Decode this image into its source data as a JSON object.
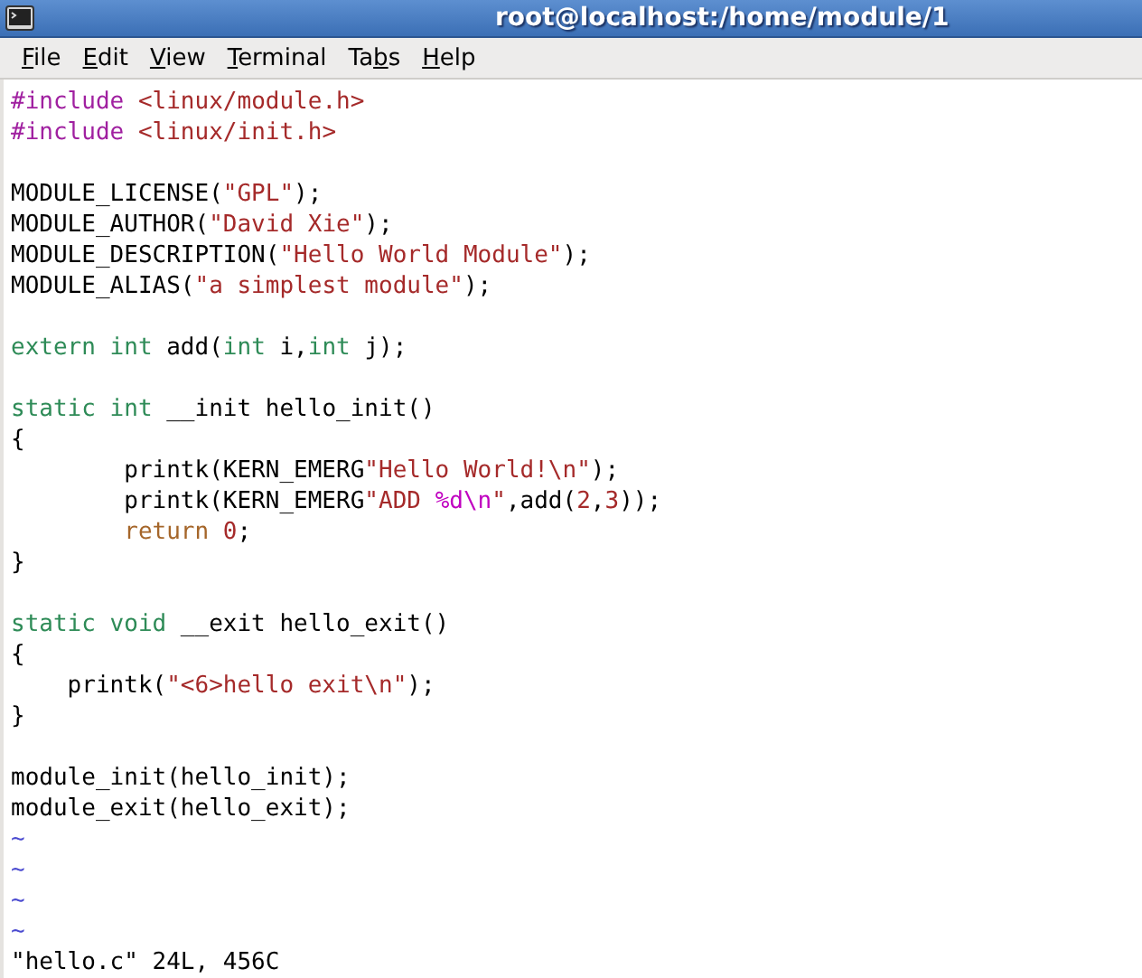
{
  "window": {
    "title": "root@localhost:/home/module/1"
  },
  "menu": [
    {
      "mnemonic": "F",
      "after": "ile"
    },
    {
      "mnemonic": "E",
      "after": "dit"
    },
    {
      "mnemonic": "V",
      "after": "iew"
    },
    {
      "mnemonic": "T",
      "after": "erminal"
    },
    {
      "before": "Ta",
      "mnemonic": "b",
      "after": "s"
    },
    {
      "mnemonic": "H",
      "after": "elp"
    }
  ],
  "editor": {
    "lines": [
      {
        "kind": "code",
        "tokens": [
          {
            "text": "#include ",
            "kind": "preproc"
          },
          {
            "text": "<linux/module.h>",
            "kind": "string"
          }
        ]
      },
      {
        "kind": "code",
        "tokens": [
          {
            "text": "#include ",
            "kind": "preproc"
          },
          {
            "text": "<linux/init.h>",
            "kind": "string"
          }
        ]
      },
      {
        "kind": "blank"
      },
      {
        "kind": "code",
        "tokens": [
          {
            "text": "MODULE_LICENSE(",
            "kind": "plain"
          },
          {
            "text": "\"GPL\"",
            "kind": "string"
          },
          {
            "text": ");",
            "kind": "plain"
          }
        ]
      },
      {
        "kind": "code",
        "tokens": [
          {
            "text": "MODULE_AUTHOR(",
            "kind": "plain"
          },
          {
            "text": "\"David Xie\"",
            "kind": "string"
          },
          {
            "text": ");",
            "kind": "plain"
          }
        ]
      },
      {
        "kind": "code",
        "tokens": [
          {
            "text": "MODULE_DESCRIPTION(",
            "kind": "plain"
          },
          {
            "text": "\"Hello World Module\"",
            "kind": "string"
          },
          {
            "text": ");",
            "kind": "plain"
          }
        ]
      },
      {
        "kind": "code",
        "tokens": [
          {
            "text": "MODULE_ALIAS(",
            "kind": "plain"
          },
          {
            "text": "\"a simplest module\"",
            "kind": "string"
          },
          {
            "text": ");",
            "kind": "plain"
          }
        ]
      },
      {
        "kind": "blank"
      },
      {
        "kind": "code",
        "tokens": [
          {
            "text": "extern int",
            "kind": "type"
          },
          {
            "text": " add(",
            "kind": "plain"
          },
          {
            "text": "int",
            "kind": "type"
          },
          {
            "text": " i,",
            "kind": "plain"
          },
          {
            "text": "int",
            "kind": "type"
          },
          {
            "text": " j);",
            "kind": "plain"
          }
        ]
      },
      {
        "kind": "blank"
      },
      {
        "kind": "code",
        "tokens": [
          {
            "text": "static int",
            "kind": "type"
          },
          {
            "text": " __init hello_init()",
            "kind": "plain"
          }
        ]
      },
      {
        "kind": "code",
        "tokens": [
          {
            "text": "{",
            "kind": "plain"
          }
        ]
      },
      {
        "kind": "code",
        "tokens": [
          {
            "text": "        printk(KERN_EMERG",
            "kind": "plain"
          },
          {
            "text": "\"Hello World!\\n\"",
            "kind": "string"
          },
          {
            "text": ");",
            "kind": "plain"
          }
        ]
      },
      {
        "kind": "code",
        "tokens": [
          {
            "text": "        printk(KERN_EMERG",
            "kind": "plain"
          },
          {
            "text": "\"ADD ",
            "kind": "string"
          },
          {
            "text": "%d\\n",
            "kind": "special"
          },
          {
            "text": "\"",
            "kind": "string"
          },
          {
            "text": ",add(",
            "kind": "plain"
          },
          {
            "text": "2",
            "kind": "string"
          },
          {
            "text": ",",
            "kind": "plain"
          },
          {
            "text": "3",
            "kind": "string"
          },
          {
            "text": "));",
            "kind": "plain"
          }
        ]
      },
      {
        "kind": "code",
        "tokens": [
          {
            "text": "        return",
            "kind": "keyword"
          },
          {
            "text": " 0",
            "kind": "string"
          },
          {
            "text": ";",
            "kind": "plain"
          }
        ]
      },
      {
        "kind": "code",
        "tokens": [
          {
            "text": "}",
            "kind": "plain"
          }
        ]
      },
      {
        "kind": "blank"
      },
      {
        "kind": "code",
        "tokens": [
          {
            "text": "static void",
            "kind": "type"
          },
          {
            "text": " __exit hello_exit()",
            "kind": "plain"
          }
        ]
      },
      {
        "kind": "code",
        "tokens": [
          {
            "text": "{",
            "kind": "plain"
          }
        ]
      },
      {
        "kind": "code",
        "tokens": [
          {
            "text": "    printk(",
            "kind": "plain"
          },
          {
            "text": "\"<6>hello exit\\n\"",
            "kind": "string"
          },
          {
            "text": ");",
            "kind": "plain"
          }
        ]
      },
      {
        "kind": "code",
        "tokens": [
          {
            "text": "}",
            "kind": "plain"
          }
        ]
      },
      {
        "kind": "blank"
      },
      {
        "kind": "code",
        "tokens": [
          {
            "text": "module_init(hello_init);",
            "kind": "plain"
          }
        ]
      },
      {
        "kind": "code",
        "tokens": [
          {
            "text": "module_exit(hello_exit);",
            "kind": "plain"
          }
        ]
      },
      {
        "kind": "tilde",
        "text": "~"
      },
      {
        "kind": "tilde",
        "text": "~"
      },
      {
        "kind": "tilde",
        "text": "~"
      },
      {
        "kind": "tilde",
        "text": "~"
      }
    ],
    "status": "\"hello.c\" 24L, 456C"
  }
}
